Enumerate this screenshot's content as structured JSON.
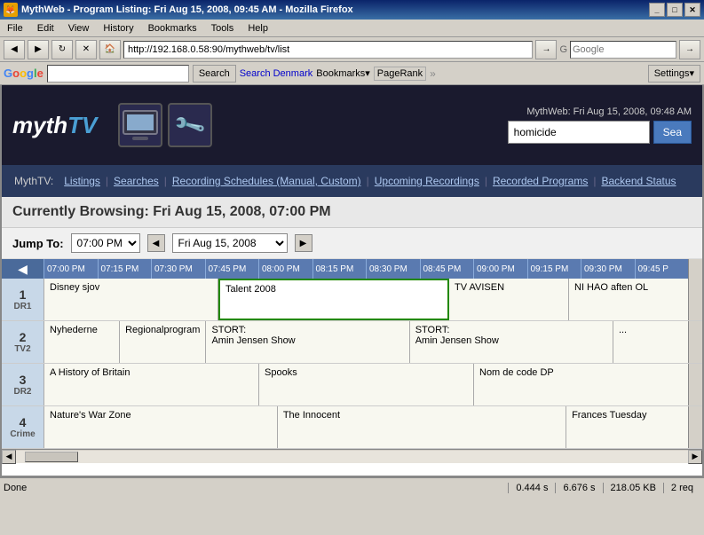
{
  "window": {
    "title": "MythWeb - Program Listing: Fri Aug 15, 2008, 09:45 AM - Mozilla Firefox",
    "favicon": "🦊"
  },
  "menu": {
    "items": [
      "File",
      "Edit",
      "View",
      "History",
      "Bookmarks",
      "Tools",
      "Help"
    ]
  },
  "toolbar": {
    "address": "http://192.168.0.58:90/mythweb/tv/list",
    "search_placeholder": "Google"
  },
  "google_bar": {
    "search_placeholder": "",
    "search_btn": "Search",
    "search_denmark_btn": "Search Denmark",
    "bookmarks_btn": "Bookmarks▾",
    "pagerank_label": "PageRank",
    "settings_btn": "Settings▾"
  },
  "mythtv": {
    "logo_text": "myth",
    "logo_span": "TV",
    "header_date": "MythWeb: Fri Aug 15, 2008, 09:48 AM",
    "search_value": "homicide",
    "search_btn": "Sea",
    "nav": {
      "prefix": "MythTV:",
      "items": [
        {
          "label": "Listings",
          "sep": "|"
        },
        {
          "label": "Searches",
          "sep": "|"
        },
        {
          "label": "Recording Schedules (Manual, Custom)",
          "sep": "|"
        },
        {
          "label": "Upcoming Recordings",
          "sep": "|"
        },
        {
          "label": "Recorded Programs",
          "sep": "|"
        },
        {
          "label": "Backend Status",
          "sep": ""
        }
      ]
    }
  },
  "listing": {
    "title": "Currently Browsing: Fri Aug 15, 2008, 07:00 PM",
    "jump_label": "Jump To:",
    "jump_time": "07:00 PM",
    "jump_date": "Fri Aug 15, 2008",
    "times": [
      "07:00 PM",
      "07:15 PM",
      "07:30 PM",
      "07:45 PM",
      "08:00 PM",
      "08:15 PM",
      "08:30 PM",
      "08:45 PM",
      "09:00 PM",
      "09:15 PM",
      "09:30 PM",
      "09:45 P"
    ],
    "channels": [
      {
        "num": "1",
        "name": "DR1",
        "programs": [
          {
            "title": "Disney sjov",
            "span": 3
          },
          {
            "title": "Talent 2008",
            "span": 4,
            "highlight": true
          },
          {
            "title": "TV AVISEN",
            "span": 2
          },
          {
            "title": "NI HAO aften OL",
            "span": 2
          }
        ]
      },
      {
        "num": "2",
        "name": "TV2",
        "programs": [
          {
            "title": "Nyhederne",
            "span": 1
          },
          {
            "title": "Regionalprogram",
            "span": 1
          },
          {
            "title": "STORT:\nAmin Jensen Show",
            "span": 3
          },
          {
            "title": "STORT:\nAmin Jensen Show",
            "span": 3
          },
          {
            "title": "...",
            "span": 1
          }
        ]
      },
      {
        "num": "3",
        "name": "DR2",
        "programs": [
          {
            "title": "A History of Britain",
            "span": 3
          },
          {
            "title": "Spooks",
            "span": 3
          },
          {
            "title": "Nom de code DP",
            "span": 3
          }
        ]
      },
      {
        "num": "4",
        "name": "Crime",
        "programs": [
          {
            "title": "Nature's War Zone",
            "span": 4
          },
          {
            "title": "The Innocent",
            "span": 5
          },
          {
            "title": "Frances Tuesday",
            "span": 2
          }
        ]
      }
    ]
  },
  "statusbar": {
    "text": "Done",
    "timing1": "0.444 s",
    "timing2": "6.676 s",
    "size": "218.05 KB",
    "requests": "2 req"
  }
}
